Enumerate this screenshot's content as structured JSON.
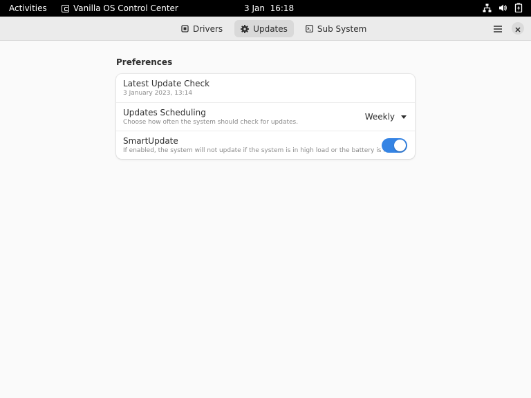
{
  "topbar": {
    "activities": "Activities",
    "app_name": "Vanilla OS Control Center",
    "clock": "3 Jan  16:18",
    "icons": [
      "network-icon",
      "volume-icon",
      "battery-icon"
    ]
  },
  "headerbar": {
    "tabs": [
      {
        "label": "Drivers",
        "icon": "chip-icon",
        "active": false
      },
      {
        "label": "Updates",
        "icon": "gear-icon",
        "active": true
      },
      {
        "label": "Sub System",
        "icon": "terminal-icon",
        "active": false
      }
    ],
    "menu_icon": "hamburger-menu-icon",
    "close_icon": "close-icon"
  },
  "preferences": {
    "title": "Preferences",
    "rows": [
      {
        "title": "Latest Update Check",
        "subtitle": "3 January 2023, 13:14"
      },
      {
        "title": "Updates Scheduling",
        "subtitle": "Choose how often the system should check for updates.",
        "value": "Weekly"
      },
      {
        "title": "SmartUpdate",
        "subtitle": "If enabled, the system will not update if the system is in high load or the battery is low.",
        "enabled": true
      }
    ]
  },
  "colors": {
    "accent": "#3584e4",
    "topbar": "#000000",
    "headerbar": "#ebebeb",
    "window": "#fafafa"
  }
}
